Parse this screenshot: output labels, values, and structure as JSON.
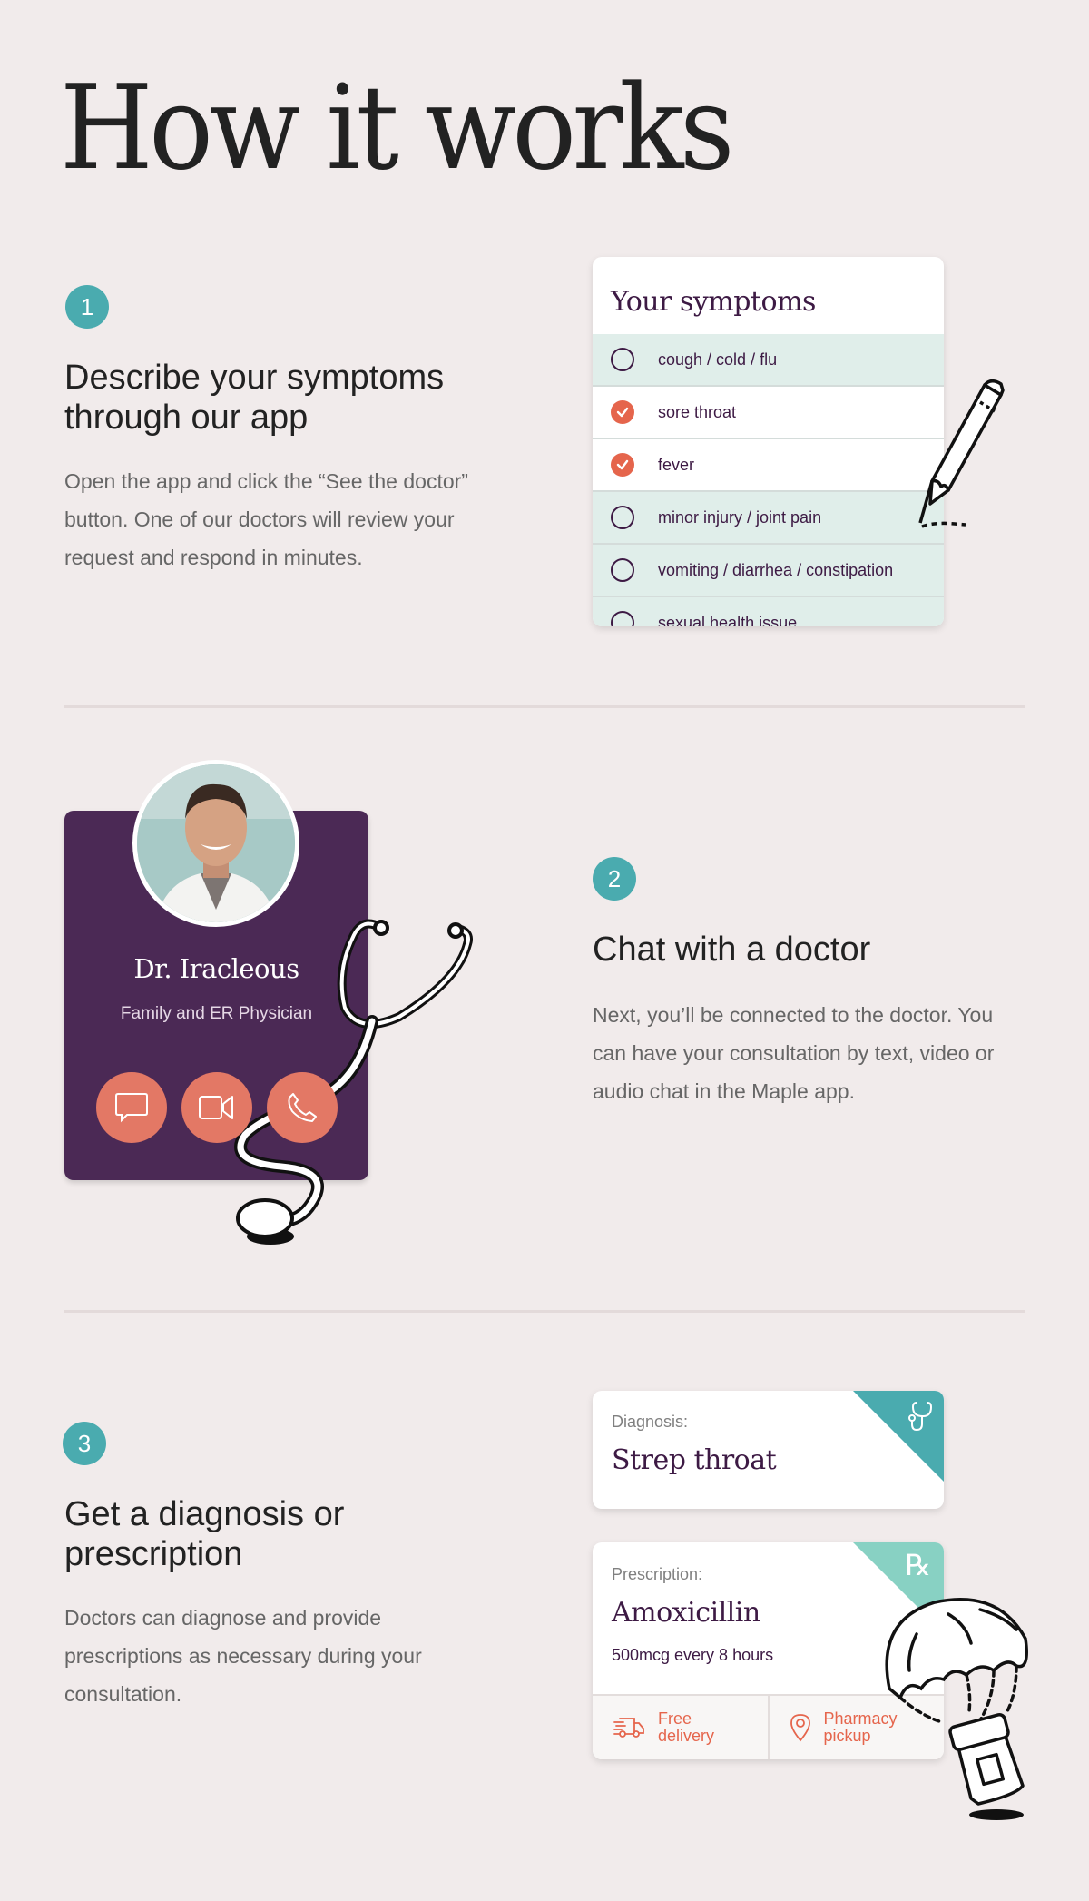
{
  "page": {
    "title": "How it works"
  },
  "colors": {
    "background": "#f1ebeb",
    "teal": "#4aabaf",
    "mint": "#88d1c3",
    "purple": "#4b2955",
    "ink_purple": "#3d1a44",
    "coral": "#e5654c",
    "coral_button": "#e37865"
  },
  "steps": [
    {
      "number": "1",
      "title_line1": "Describe your symptoms",
      "title_line2": "through our app",
      "description": "Open the app and click the “See the doctor” button. One of our doctors will review your request and respond in minutes."
    },
    {
      "number": "2",
      "title": "Chat with a doctor",
      "description": "Next, you’ll be connected to the doctor. You can have your consultation by text, video or audio chat in the Maple app."
    },
    {
      "number": "3",
      "title_line1": "Get a diagnosis or",
      "title_line2": "prescription",
      "description": "Doctors can diagnose and provide prescriptions as necessary during your consultation."
    }
  ],
  "symptoms_card": {
    "title": "Your symptoms",
    "items": [
      {
        "label": "cough / cold / flu",
        "checked": false
      },
      {
        "label": "sore throat",
        "checked": true
      },
      {
        "label": "fever",
        "checked": true
      },
      {
        "label": "minor injury / joint pain",
        "checked": false
      },
      {
        "label": "vomiting / diarrhea / constipation",
        "checked": false
      },
      {
        "label": "sexual health issue",
        "checked": false
      }
    ],
    "icons": {
      "checked": "check-circle-icon",
      "unchecked": "empty-circle-icon",
      "illustration": "pencil-icon"
    }
  },
  "doctor_card": {
    "name": "Dr. Iracleous",
    "specialty": "Family and ER Physician",
    "actions": [
      {
        "icon": "chat-bubble-icon",
        "label": "text chat"
      },
      {
        "icon": "video-camera-icon",
        "label": "video chat"
      },
      {
        "icon": "phone-icon",
        "label": "audio chat"
      }
    ],
    "illustration": "stethoscope-icon"
  },
  "diagnosis_card": {
    "label": "Diagnosis:",
    "value": "Strep throat",
    "icon": "stethoscope-icon"
  },
  "prescription_card": {
    "label": "Prescription:",
    "value": "Amoxicillin",
    "dosage": "500mcg every 8 hours",
    "icon": "rx-icon",
    "rx_symbol": "℞",
    "options": [
      {
        "icon": "delivery-truck-icon",
        "line1": "Free",
        "line2": "delivery"
      },
      {
        "icon": "location-pin-icon",
        "line1": "Pharmacy",
        "line2": "pickup"
      }
    ],
    "illustration": "parachute-pill-bottle-icon"
  }
}
